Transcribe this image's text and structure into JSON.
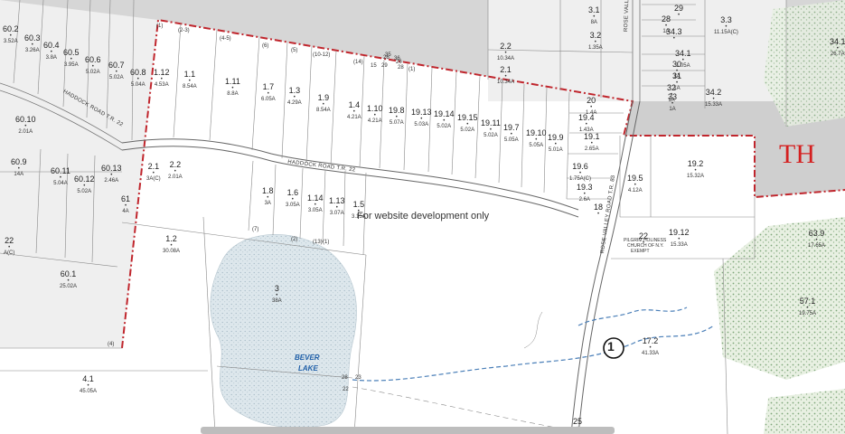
{
  "notice": "For website development only",
  "big_label": "TH",
  "circle_label": "1",
  "lake": {
    "line1": "BEVER",
    "line2": "LAKE"
  },
  "roads": {
    "haddock_upper": "HADDOCK ROAD T.R. 22",
    "haddock_west": "HADDOCK ROAD T.R. 22",
    "rose_valley_north": "ROSE VALLEY ROAD T.R.",
    "rose_valley_south": "ROSE VALLEY ROAD T.R. 83"
  },
  "church": [
    "PILGRIM HOLINESS",
    "CHURCH OF N.Y.",
    "EXEMPT"
  ],
  "highlighted_parcel": "1.4",
  "parcels": [
    {
      "id": "60.2",
      "acres": "3.52A"
    },
    {
      "id": "60.3",
      "acres": "3.26A"
    },
    {
      "id": "60.4",
      "acres": "3.8A"
    },
    {
      "id": "60.5",
      "acres": "3.95A"
    },
    {
      "id": "60.6",
      "acres": "5.02A"
    },
    {
      "id": "60.7",
      "acres": "5.02A"
    },
    {
      "id": "60.8",
      "acres": "5.04A"
    },
    {
      "id": "1.12",
      "acres": "4.53A"
    },
    {
      "id": "1.1",
      "acres": "8.54A"
    },
    {
      "id": "1.11",
      "acres": "8.8A"
    },
    {
      "id": "1.7",
      "acres": "6.05A"
    },
    {
      "id": "1.3",
      "acres": "4.29A"
    },
    {
      "id": "1.9",
      "acres": "8.54A"
    },
    {
      "id": "1.4",
      "acres": "4.21A"
    },
    {
      "id": "1.10",
      "acres": "4.21A"
    },
    {
      "id": "19.8",
      "acres": "5.07A"
    },
    {
      "id": "19.13",
      "acres": "5.03A"
    },
    {
      "id": "19.14",
      "acres": "5.02A"
    },
    {
      "id": "19.15",
      "acres": "5.02A"
    },
    {
      "id": "19.11",
      "acres": "5.02A"
    },
    {
      "id": "19.7",
      "acres": "5.05A"
    },
    {
      "id": "19.10",
      "acres": "5.05A"
    },
    {
      "id": "19.9",
      "acres": "5.01A"
    },
    {
      "id": "20",
      "acres": "1.4A"
    },
    {
      "id": "19.4",
      "acres": "1.43A"
    },
    {
      "id": "19.1",
      "acres": "2.65A"
    },
    {
      "id": "19.6",
      "acres": "1.75A(C)"
    },
    {
      "id": "19.3",
      "acres": "2.6A"
    },
    {
      "id": "18",
      "acres": ""
    },
    {
      "id": "19.5",
      "acres": "4.12A"
    },
    {
      "id": "19.2",
      "acres": "15.32A"
    },
    {
      "id": "19.12",
      "acres": "15.33A"
    },
    {
      "id": "22",
      "acres": ""
    },
    {
      "id": "2.2",
      "acres": "10.34A"
    },
    {
      "id": "2.1",
      "acres": "10.34A"
    },
    {
      "id": "3.1",
      "acres": "8A"
    },
    {
      "id": "3.2",
      "acres": "1.35A"
    },
    {
      "id": "3.3",
      "acres": "11.15A(C)"
    },
    {
      "id": "29",
      "acres": ""
    },
    {
      "id": "28",
      "acres": "1A"
    },
    {
      "id": "34.3",
      "acres": ""
    },
    {
      "id": "34.1",
      "acres": "1.05A"
    },
    {
      "id": "30",
      "acres": "1A"
    },
    {
      "id": "31",
      "acres": "1A"
    },
    {
      "id": "32",
      "acres": "1A"
    },
    {
      "id": "33",
      "acres": "1A"
    },
    {
      "id": "34.2",
      "acres": "15.33A"
    },
    {
      "id": "34.1",
      "acres": "26.7A"
    },
    {
      "id": "60.10",
      "acres": "2.01A"
    },
    {
      "id": "60.9",
      "acres": "14A"
    },
    {
      "id": "60.11",
      "acres": "5.04A"
    },
    {
      "id": "60.12",
      "acres": "5.02A"
    },
    {
      "id": "60.13",
      "acres": "2.46A"
    },
    {
      "id": "2.1",
      "acres": "3A(C)"
    },
    {
      "id": "2.2",
      "acres": "2.01A"
    },
    {
      "id": "61",
      "acres": "4A"
    },
    {
      "id": "1.8",
      "acres": "3A"
    },
    {
      "id": "1.6",
      "acres": "3.05A"
    },
    {
      "id": "1.14",
      "acres": "3.05A"
    },
    {
      "id": "1.13",
      "acres": "3.07A"
    },
    {
      "id": "1.5",
      "acres": "3.15A"
    },
    {
      "id": "22",
      "acres": "A(C)"
    },
    {
      "id": "1.2",
      "acres": "30.08A"
    },
    {
      "id": "3",
      "acres": "38A"
    },
    {
      "id": "60.1",
      "acres": "25.02A"
    },
    {
      "id": "4.1",
      "acres": "45.05A"
    },
    {
      "id": "17.2",
      "acres": "41.33A"
    },
    {
      "id": "63.9",
      "acres": "17.65A"
    },
    {
      "id": "57.1",
      "acres": "19.75A"
    },
    {
      "id": "25",
      "acres": ""
    }
  ],
  "lot_numbers": [
    "(1)",
    "(2-3)",
    "(4-5)",
    "(6)",
    "(5)",
    "(10-12)",
    "(14)",
    "15",
    "29",
    "28",
    "26",
    "(1)",
    "(7)",
    "(2)",
    "(13)",
    "(1)",
    "(4)",
    "35",
    "36",
    "26",
    "28",
    "23",
    "22"
  ]
}
